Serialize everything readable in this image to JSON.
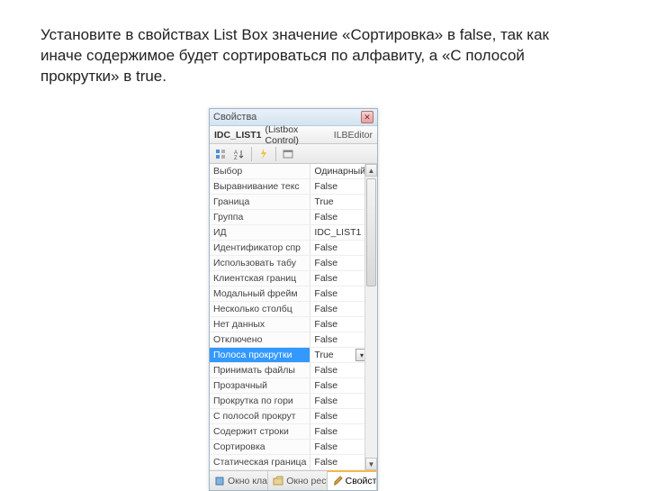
{
  "instruction": "Установите в свойствах List Box значение «Сортировка» в false, так как иначе содержимое будет сортироваться по алфавиту, а «С полосой прокрутки» в true.",
  "panel": {
    "title": "Свойства",
    "selector_name": "IDC_LIST1",
    "selector_type": "(Listbox Control)",
    "selector_class": "ILBEditor"
  },
  "props": [
    {
      "k": "Выбор",
      "v": "Одинарный"
    },
    {
      "k": "Выравнивание текс",
      "v": "False"
    },
    {
      "k": "Граница",
      "v": "True"
    },
    {
      "k": "Группа",
      "v": "False"
    },
    {
      "k": "ИД",
      "v": "IDC_LIST1"
    },
    {
      "k": "Идентификатор спр",
      "v": "False"
    },
    {
      "k": "Использовать табу",
      "v": "False"
    },
    {
      "k": "Клиентская границ",
      "v": "False"
    },
    {
      "k": "Модальный фрейм",
      "v": "False"
    },
    {
      "k": "Несколько столбц",
      "v": "False"
    },
    {
      "k": "Нет данных",
      "v": "False"
    },
    {
      "k": "Отключено",
      "v": "False"
    },
    {
      "k": "Полоса прокрутки",
      "v": "True",
      "selected": true
    },
    {
      "k": "Принимать файлы",
      "v": "False"
    },
    {
      "k": "Прозрачный",
      "v": "False"
    },
    {
      "k": "Прокрутка по гори",
      "v": "False"
    },
    {
      "k": "С полосой прокрут",
      "v": "False"
    },
    {
      "k": "Содержит строки",
      "v": "False"
    },
    {
      "k": "Сортировка",
      "v": "False"
    },
    {
      "k": "Статическая граница",
      "v": "False"
    }
  ],
  "tabs": {
    "t1": "Окно клас…",
    "t2": "Окно ресу…",
    "t3": "Свойства"
  }
}
